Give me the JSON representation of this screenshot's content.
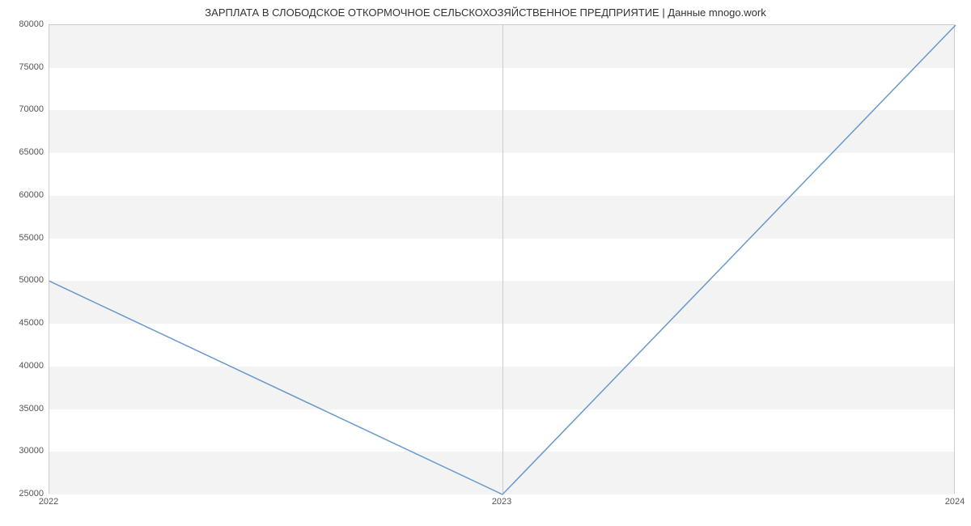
{
  "chart_data": {
    "type": "line",
    "title": "ЗАРПЛАТА В  СЛОБОДСКОЕ ОТКОРМОЧНОЕ СЕЛЬСКОХОЗЯЙСТВЕННОЕ ПРЕДПРИЯТИЕ | Данные mnogo.work",
    "categories": [
      "2022",
      "2023",
      "2024"
    ],
    "values": [
      50000,
      25000,
      80000
    ],
    "xlabel": "",
    "ylabel": "",
    "ylim": [
      25000,
      80000
    ],
    "yticks": [
      25000,
      30000,
      35000,
      40000,
      45000,
      50000,
      55000,
      60000,
      65000,
      70000,
      75000,
      80000
    ],
    "line_color": "#6699cc"
  }
}
